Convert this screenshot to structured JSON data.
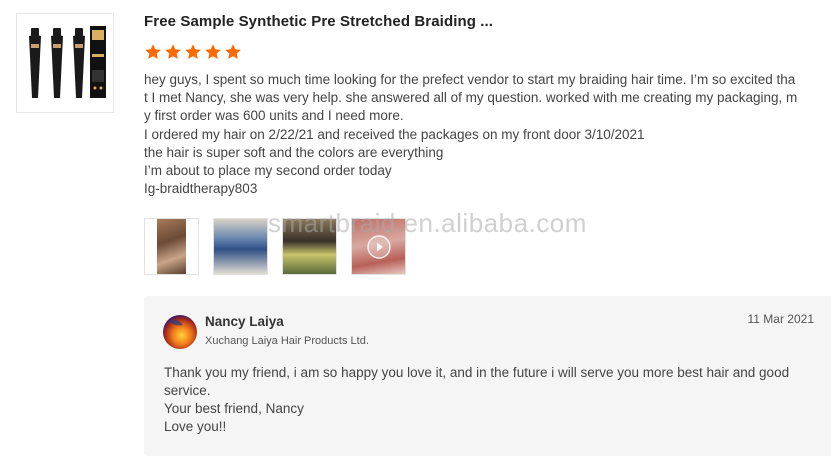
{
  "product": {
    "title": "Free Sample Synthetic Pre Stretched Braiding ...",
    "thumbnail_icon": "hair-bundle-product-image"
  },
  "review": {
    "rating": 5,
    "rating_max": 5,
    "star_color": "#ff6a00",
    "paragraphs": [
      "hey guys, I spent so much time looking for the prefect vendor to start my braiding hair time. I’m so excited that I met Nancy, she was very help. she answered all of my question. worked with me creating my packaging, my first order was 600 units and I need more.",
      "I ordered my hair on 2/22/21 and received the packages on my front door 3/10/2021",
      "the hair is super soft and the colors are everything",
      "I’m about to place my second  order today",
      "Ig-braidtherapy803"
    ],
    "media": [
      {
        "type": "image",
        "icon": "photo-thumbnail"
      },
      {
        "type": "image",
        "icon": "photo-thumbnail"
      },
      {
        "type": "image",
        "icon": "photo-thumbnail"
      },
      {
        "type": "video",
        "icon": "play-icon"
      }
    ]
  },
  "watermark": "smartbraid.en.alibaba.com",
  "reply": {
    "name": "Nancy Laiya",
    "company": "Xuchang Laiya Hair Products Ltd.",
    "date": "11 Mar 2021",
    "paragraphs": [
      "Thank you my friend, i am so happy you love it, and in the future i will serve you more best hair and good service.",
      "Your best friend, Nancy",
      "Love you!!"
    ]
  }
}
